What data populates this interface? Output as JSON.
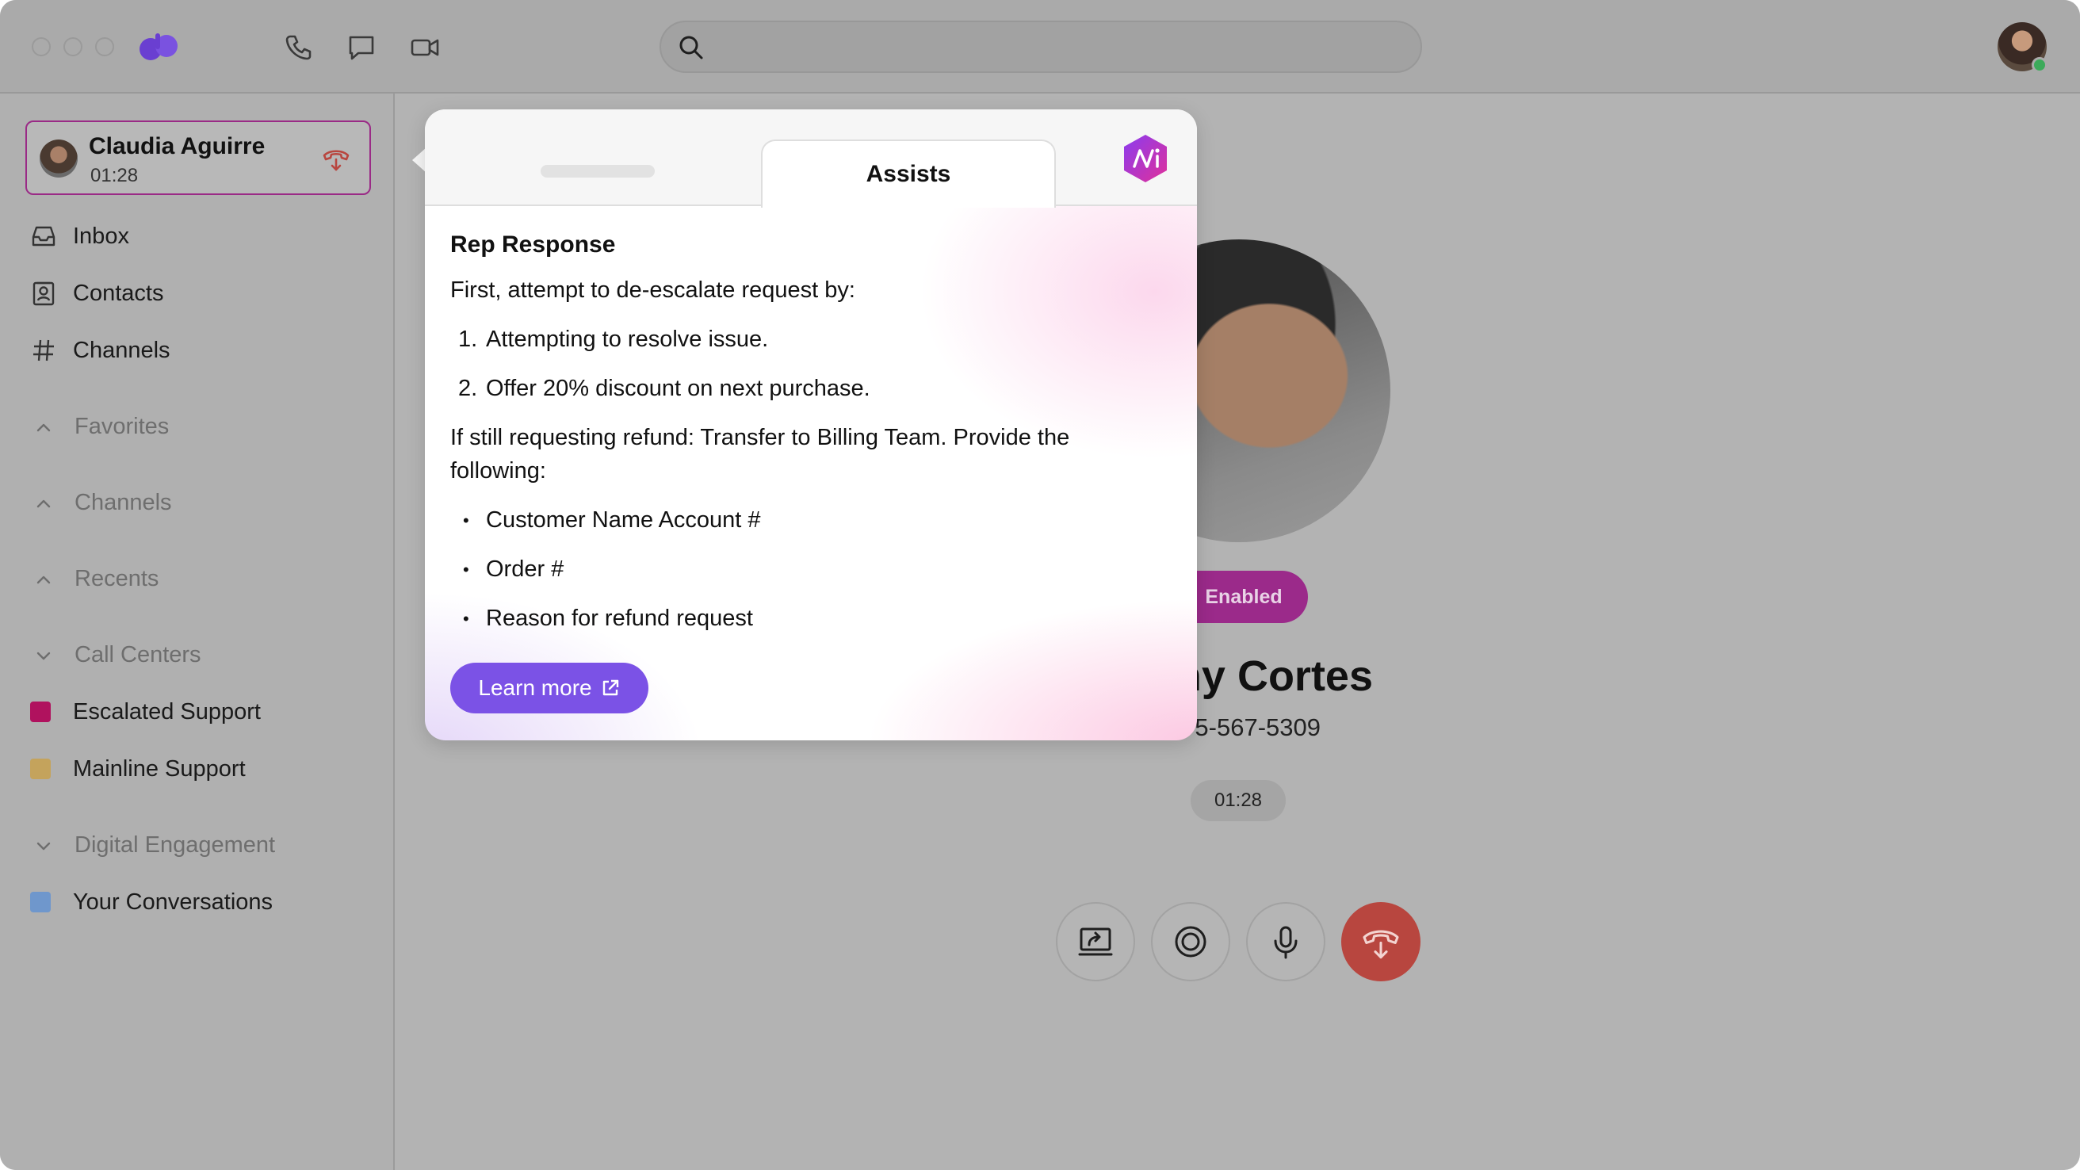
{
  "window": {
    "traffic_lights": [
      "close",
      "minimize",
      "zoom"
    ]
  },
  "toolbar": {
    "icons": [
      "phone-icon",
      "chat-icon",
      "video-icon"
    ],
    "search": {
      "placeholder": "",
      "value": ""
    }
  },
  "active_call": {
    "name": "Claudia Aguirre",
    "duration": "01:28"
  },
  "sidebar": {
    "nav": [
      {
        "label": "Inbox",
        "icon": "inbox-icon"
      },
      {
        "label": "Contacts",
        "icon": "contacts-icon"
      },
      {
        "label": "Channels",
        "icon": "hash-icon"
      }
    ],
    "sections": {
      "favorites": "Favorites",
      "channels": "Channels",
      "recents": "Recents",
      "call_centers": "Call Centers",
      "digital_engagement": "Digital Engagement"
    },
    "call_centers": [
      {
        "label": "Escalated Support",
        "color": "#b0125e"
      },
      {
        "label": "Mainline Support",
        "color": "#c4a35c"
      }
    ],
    "digital": [
      {
        "label": "Your Conversations",
        "color": "#6f97cc"
      }
    ]
  },
  "call": {
    "badge": "Enabled",
    "caller_name": "ny Cortes",
    "caller_phone": "5-567-5309",
    "timer": "01:28"
  },
  "assist": {
    "tab_active": "Assists",
    "title": "Rep Response",
    "intro": "First, attempt to de-escalate request by:",
    "steps": [
      {
        "num": "1.",
        "text": "Attempting to resolve issue."
      },
      {
        "num": "2.",
        "text": "Offer 20% discount on next purchase."
      }
    ],
    "refund_line1": "If still requesting refund: Transfer to Billing Team. Provide the",
    "refund_line2": "following:",
    "bullets": [
      "Customer Name Account #",
      "Order #",
      "Reason for refund request"
    ],
    "learn_more": "Learn more"
  },
  "colors": {
    "accent_purple": "#7b52e6",
    "badge_magenta": "#9b2a8a",
    "end_call_red": "#b8463f",
    "online_green": "#3caa5a"
  }
}
